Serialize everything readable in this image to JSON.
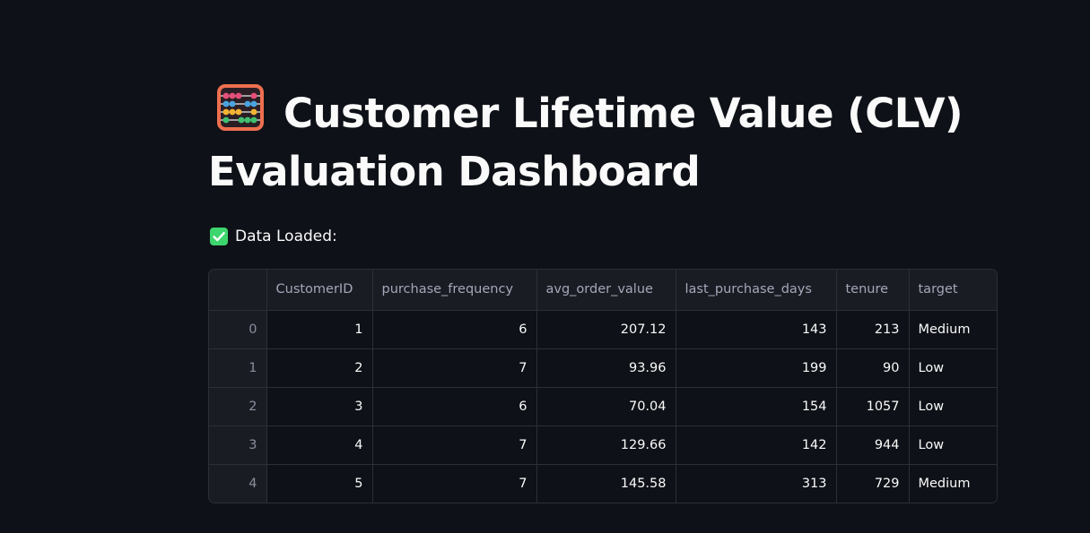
{
  "header": {
    "title_line1": "Customer Lifetime Value (CLV)",
    "title_line2": "Evaluation Dashboard",
    "title_icon": "abacus-emoji"
  },
  "status": {
    "icon": "check-mark-button-emoji",
    "text": "Data Loaded:",
    "color": "#3dd56d"
  },
  "table": {
    "columns": [
      "",
      "CustomerID",
      "purchase_frequency",
      "avg_order_value",
      "last_purchase_days",
      "tenure",
      "target"
    ],
    "rows": [
      {
        "index": "0",
        "CustomerID": "1",
        "purchase_frequency": "6",
        "avg_order_value": "207.12",
        "last_purchase_days": "143",
        "tenure": "213",
        "target": "Medium"
      },
      {
        "index": "1",
        "CustomerID": "2",
        "purchase_frequency": "7",
        "avg_order_value": "93.96",
        "last_purchase_days": "199",
        "tenure": "90",
        "target": "Low"
      },
      {
        "index": "2",
        "CustomerID": "3",
        "purchase_frequency": "6",
        "avg_order_value": "70.04",
        "last_purchase_days": "154",
        "tenure": "1057",
        "target": "Low"
      },
      {
        "index": "3",
        "CustomerID": "4",
        "purchase_frequency": "7",
        "avg_order_value": "129.66",
        "last_purchase_days": "142",
        "tenure": "944",
        "target": "Low"
      },
      {
        "index": "4",
        "CustomerID": "5",
        "purchase_frequency": "7",
        "avg_order_value": "145.58",
        "last_purchase_days": "313",
        "tenure": "729",
        "target": "Medium"
      }
    ]
  },
  "colors": {
    "background": "#0e1117",
    "header_cell": "#1a1c24",
    "border": "#2b2f38",
    "text": "#fafafa"
  }
}
